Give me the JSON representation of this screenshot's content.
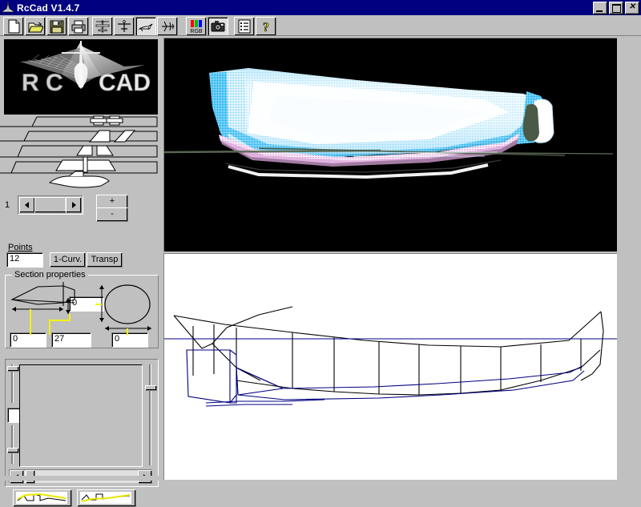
{
  "window": {
    "title": "RcCad V1.4.7",
    "icon": "aircraft-icon",
    "buttons": {
      "minimize": "_",
      "maximize": "□",
      "close": "✕"
    }
  },
  "toolbar": {
    "groups": [
      {
        "name": "file",
        "items": [
          {
            "name": "new-document-icon",
            "label": "New",
            "pressed": false
          },
          {
            "name": "open-folder-icon",
            "label": "Open",
            "pressed": false
          },
          {
            "name": "save-disk-icon",
            "label": "Save",
            "pressed": false
          },
          {
            "name": "printer-icon",
            "label": "Print",
            "pressed": false
          }
        ]
      },
      {
        "name": "views",
        "items": [
          {
            "name": "top-view-icon",
            "label": "Top view",
            "pressed": false
          },
          {
            "name": "front-view-icon",
            "label": "Front view",
            "pressed": false
          },
          {
            "name": "side-view-icon",
            "label": "Side view",
            "pressed": true
          },
          {
            "name": "perspective-view-icon",
            "label": "3D view",
            "pressed": false
          }
        ]
      },
      {
        "name": "render",
        "items": [
          {
            "name": "rgb-color-icon",
            "label": "RGB",
            "pressed": false
          },
          {
            "name": "camera-icon",
            "label": "Snapshot",
            "pressed": true
          }
        ]
      },
      {
        "name": "misc",
        "items": [
          {
            "name": "report-list-icon",
            "label": "Report",
            "pressed": false
          },
          {
            "name": "help-question-icon",
            "label": "Help",
            "pressed": false
          }
        ]
      }
    ]
  },
  "sidebar": {
    "logo": {
      "text_left": "R C",
      "text_right": "CAD"
    },
    "tabs": [
      {
        "name": "tab-plan-view",
        "label": ""
      },
      {
        "name": "tab-wing-view",
        "label": ""
      },
      {
        "name": "tab-tail-view",
        "label": ""
      },
      {
        "name": "tab-fuselage-view",
        "label": ""
      }
    ],
    "section_selector": {
      "index_label": "1",
      "prev_arrow": "◀",
      "next_arrow": "▶",
      "plus_label": "+",
      "minus_label": "-"
    },
    "points": {
      "label": "Points",
      "value": "12",
      "curve_button": "1-Curv.",
      "transp_button": "Transp"
    },
    "section_properties": {
      "title": "Section properties",
      "field_offset_x": "0",
      "field_length": "27",
      "field_height": "0",
      "field_width": "0"
    },
    "curve_editor": {
      "preset_left": "curve-preset-profile-icon",
      "preset_right": "curve-preset-plan-icon",
      "scroll_left_arrow": "◀",
      "scroll_right_arrow": "▶"
    }
  },
  "viewport_3d": {
    "name": "shaded-3d-fuselage-view",
    "background": "#000000",
    "body_color": "#ffffff",
    "shade_color": "#29b6f2",
    "accent_color": "#d8a0d8",
    "axis_color": "#4a5a46"
  },
  "viewport_wireframe": {
    "name": "wireframe-side-view",
    "background": "#ffffff",
    "outline_color": "#000000",
    "construction_color": "#000080"
  }
}
